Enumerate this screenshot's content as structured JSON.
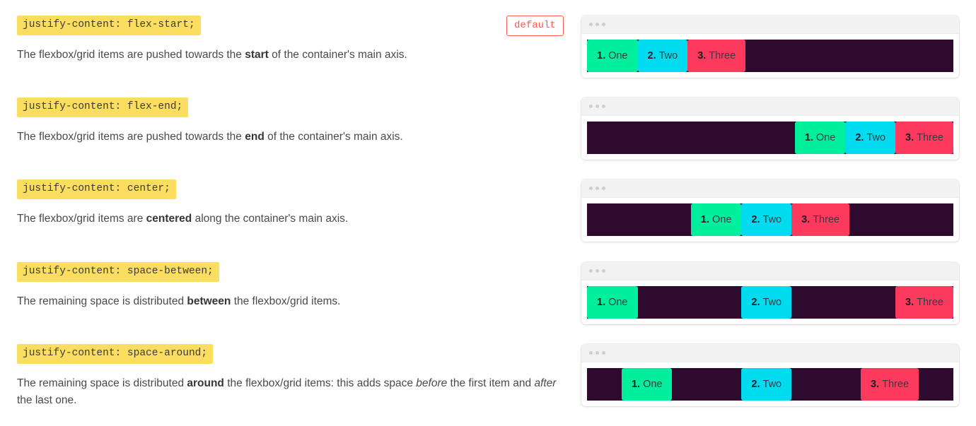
{
  "default_badge": "default",
  "items": [
    {
      "num": "1.",
      "label": "One",
      "color": "#00ef9d"
    },
    {
      "num": "2.",
      "label": "Two",
      "color": "#00dbef"
    },
    {
      "num": "3.",
      "label": "Three",
      "color": "#fb3a5d"
    }
  ],
  "colors": {
    "code_highlight_bg": "#FBDD5F",
    "container_bg": "#2d0a2e",
    "panel_head_bg": "#f2f2f2",
    "badge_accent": "#ff5b52",
    "body_text": "#4a4a4a"
  },
  "sections": [
    {
      "code": "justify-content: flex-start;",
      "value": "flex-start",
      "desc_parts": [
        {
          "t": "The flexbox/grid items are pushed towards the ",
          "s": "normal"
        },
        {
          "t": "start",
          "s": "bold"
        },
        {
          "t": " of the container's main axis.",
          "s": "normal"
        }
      ],
      "has_default_badge": true
    },
    {
      "code": "justify-content: flex-end;",
      "value": "flex-end",
      "desc_parts": [
        {
          "t": "The flexbox/grid items are pushed towards the ",
          "s": "normal"
        },
        {
          "t": "end",
          "s": "bold"
        },
        {
          "t": " of the container's main axis.",
          "s": "normal"
        }
      ],
      "has_default_badge": false
    },
    {
      "code": "justify-content: center;",
      "value": "center",
      "desc_parts": [
        {
          "t": "The flexbox/grid items are ",
          "s": "normal"
        },
        {
          "t": "centered",
          "s": "bold"
        },
        {
          "t": " along the container's main axis.",
          "s": "normal"
        }
      ],
      "has_default_badge": false
    },
    {
      "code": "justify-content: space-between;",
      "value": "space-between",
      "desc_parts": [
        {
          "t": "The remaining space is distributed ",
          "s": "normal"
        },
        {
          "t": "between",
          "s": "bold"
        },
        {
          "t": " the flexbox/grid items.",
          "s": "normal"
        }
      ],
      "has_default_badge": false
    },
    {
      "code": "justify-content: space-around;",
      "value": "space-around",
      "desc_parts": [
        {
          "t": "The remaining space is distributed ",
          "s": "normal"
        },
        {
          "t": "around",
          "s": "bold"
        },
        {
          "t": " the flexbox/grid items: this adds space ",
          "s": "normal"
        },
        {
          "t": "before",
          "s": "italic"
        },
        {
          "t": " the first item and ",
          "s": "normal"
        },
        {
          "t": "after",
          "s": "italic"
        },
        {
          "t": " the last one.",
          "s": "normal"
        }
      ],
      "has_default_badge": false
    }
  ]
}
